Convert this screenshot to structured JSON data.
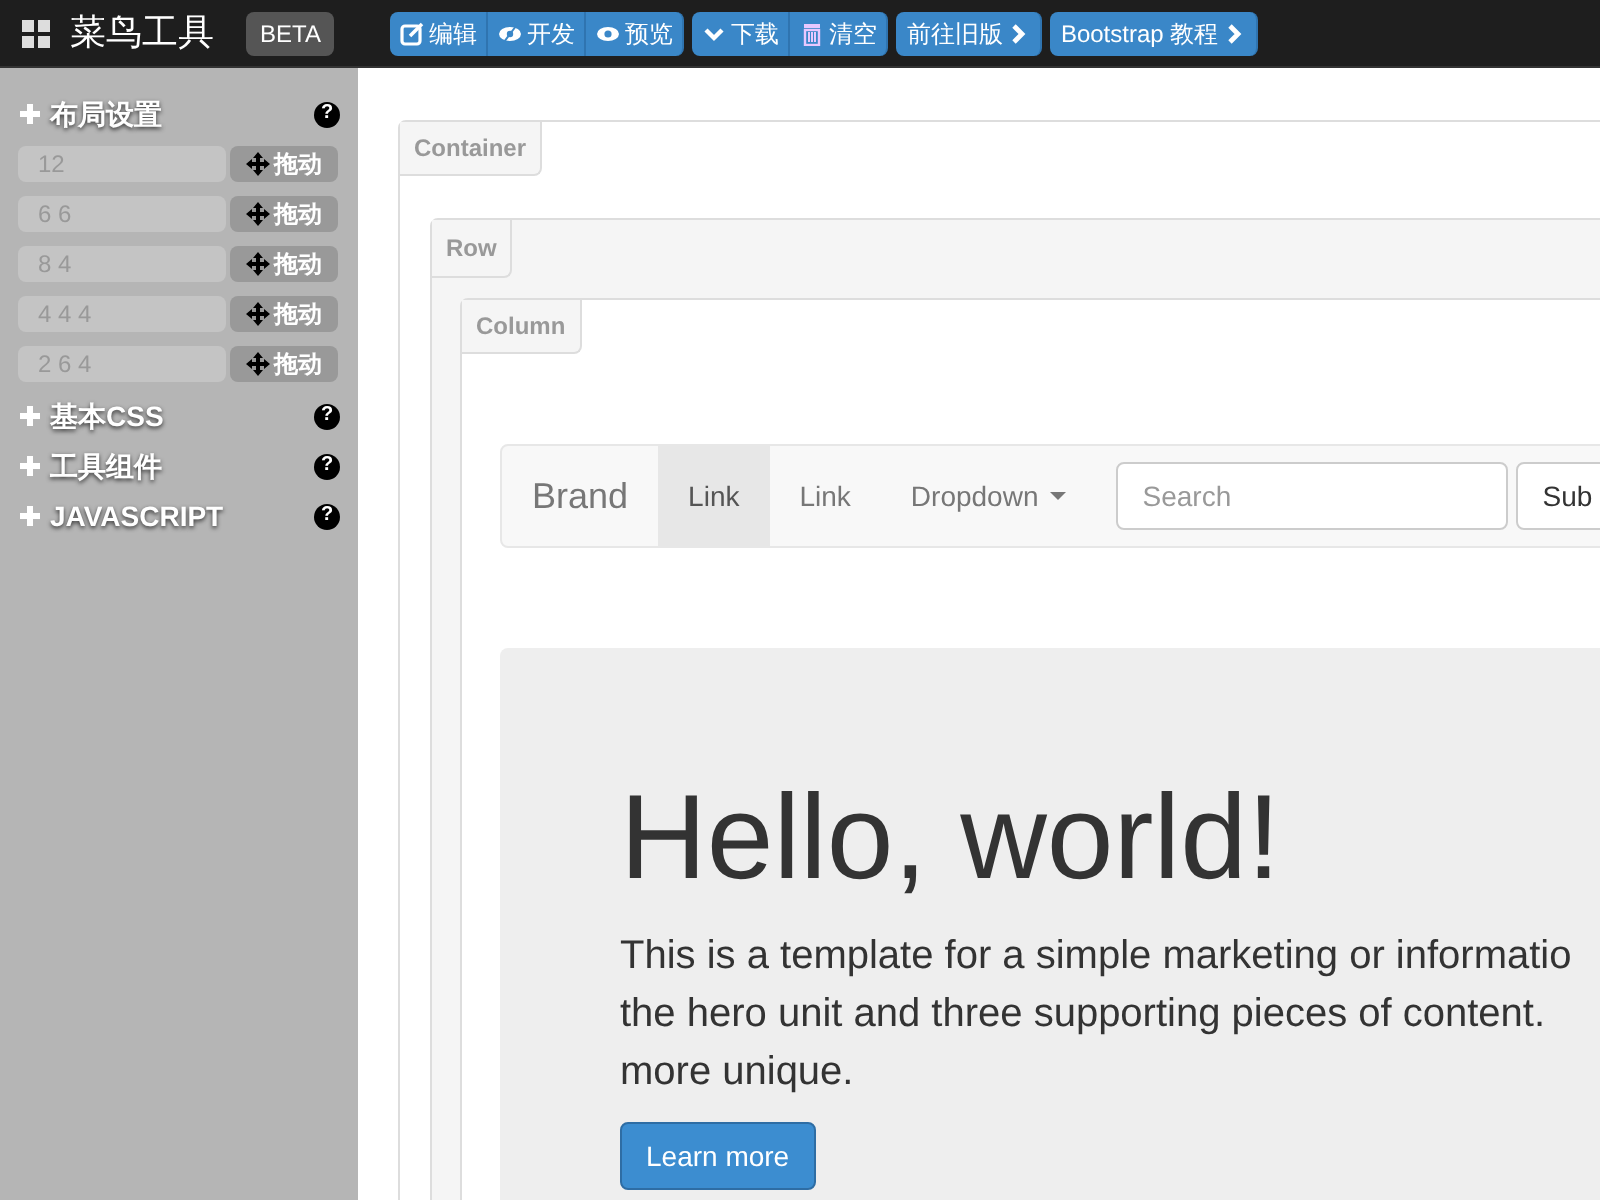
{
  "topbar": {
    "logo": "菜鸟工具",
    "badge": "BETA",
    "button_groups": [
      [
        {
          "label": "编辑",
          "kind": "edit"
        },
        {
          "label": "开发",
          "kind": "develop"
        },
        {
          "label": "预览",
          "kind": "preview"
        }
      ],
      [
        {
          "label": "下载",
          "kind": "download"
        },
        {
          "label": "清空",
          "kind": "clear"
        }
      ],
      [
        {
          "label": "前往旧版",
          "kind": "link"
        }
      ],
      [
        {
          "label": "Bootstrap 教程",
          "kind": "link"
        }
      ]
    ]
  },
  "sidebar": {
    "sections": [
      {
        "title": "布局设置",
        "help": "?",
        "rows": [
          {
            "value": "12",
            "drag": "拖动"
          },
          {
            "value": "6 6",
            "drag": "拖动"
          },
          {
            "value": "8 4",
            "drag": "拖动"
          },
          {
            "value": "4 4 4",
            "drag": "拖动"
          },
          {
            "value": "2 6 4",
            "drag": "拖动"
          }
        ]
      },
      {
        "title": "基本CSS",
        "help": "?"
      },
      {
        "title": "工具组件",
        "help": "?"
      },
      {
        "title": "JAVASCRIPT",
        "help": "?"
      }
    ]
  },
  "canvas": {
    "container_label": "Container",
    "row_label": "Row",
    "column_label": "Column",
    "navbar": {
      "brand": "Brand",
      "links": [
        {
          "label": "Link",
          "selected": true
        },
        {
          "label": "Link",
          "selected": false
        }
      ],
      "dropdown": "Dropdown",
      "search_placeholder": "Search",
      "submit": "Sub"
    },
    "jumbotron": {
      "heading": "Hello, world!",
      "lines": [
        "This is a template for a simple marketing or informatio",
        "the hero unit and three supporting pieces of content.",
        "more unique."
      ],
      "button": "Learn more"
    }
  }
}
